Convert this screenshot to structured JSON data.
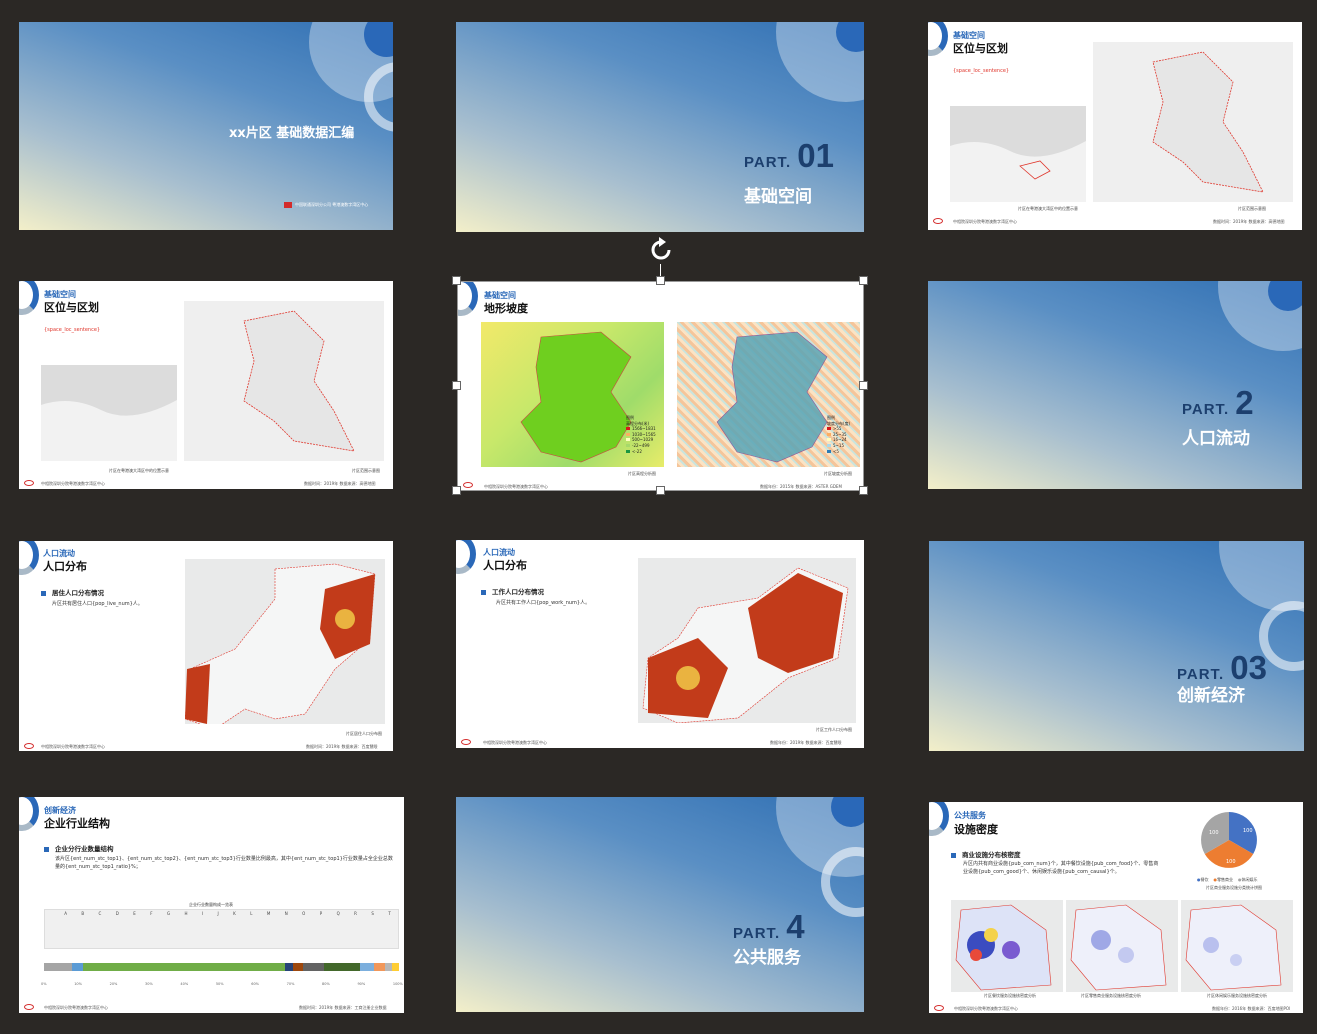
{
  "slides": {
    "s1": {
      "title": "xx片区 基础数据汇编",
      "footer": "中国联通深圳分公司 粤港澳数字湾区中心"
    },
    "s2": {
      "part_label": "PART.",
      "part_num": "01",
      "part_name": "基础空间"
    },
    "s3": {
      "section": "基础空间",
      "title": "区位与区划",
      "placeholder": "{space_loc_sentence}",
      "cap_left": "片区在粤港澳大湾区中的位置示意",
      "cap_right": "片区范围示意图",
      "footer_left": "中相院深圳分院粤港澳数字湾区中心",
      "footer_right": "数据时间：2019年   数据来源：高德地图"
    },
    "s4": {
      "section": "基础空间",
      "title": "区位与区划",
      "placeholder": "{space_loc_sentence}",
      "cap_left": "片区在粤港澳大湾区中的位置示意",
      "cap_right": "片区范围示意图",
      "footer_left": "中相院深圳分院粤港澳数字湾区中心",
      "footer_right": "数据时间：2019年   数据来源：高德地图"
    },
    "s5": {
      "section": "基础空间",
      "title": "地形坡度",
      "legend1_title": "图例",
      "legend1_sub": "高程分布(米)",
      "legend1": [
        "1566~1831",
        "1030~1565",
        "500~1029",
        "-22~499",
        "<-22"
      ],
      "legend2_title": "图例",
      "legend2_sub": "坡度分布(度)",
      "legend2": [
        ">55",
        "25~35",
        "16~24",
        "5~15",
        "<5"
      ],
      "cap_left": "片区高程分析图",
      "cap_right": "片区坡度分析图",
      "footer_left": "中相院深圳分院粤港澳数字湾区中心",
      "footer_right": "数据年份：2015年   数据来源：ASTER GDEM"
    },
    "s6": {
      "part_label": "PART.",
      "part_num": "2",
      "part_name": "人口流动"
    },
    "s7": {
      "section": "人口流动",
      "title": "人口分布",
      "bullet": "居住人口分布情况",
      "body": "片区共有居住人口{pop_live_num}人。",
      "cap": "片区居住人口分布图",
      "footer_left": "中相院深圳分院粤港澳数字湾区中心",
      "footer_right": "数据时间：2019年   数据来源：百度慧眼"
    },
    "s8": {
      "section": "人口流动",
      "title": "人口分布",
      "bullet": "工作人口分布情况",
      "body": "片区共有工作人口{pop_work_num}人。",
      "cap": "片区工作人口分布图",
      "footer_left": "中相院深圳分院粤港澳数字湾区中心",
      "footer_right": "数据年份：2019年   数据来源：百度慧眼"
    },
    "s9": {
      "part_label": "PART.",
      "part_num": "03",
      "part_name": "创新经济"
    },
    "s10": {
      "section": "创新经济",
      "title": "企业行业结构",
      "bullet": "企业分行业数量结构",
      "body": "该片区{ent_num_stc_top1}、{ent_num_stc_top2}、{ent_num_stc_top3}行业数量比例最高，其中{ent_num_stc_top1}行业数量占全企业总数量的{ent_num_stc_top1_ratio}%；",
      "table_title": "企业行业数量构成一览表",
      "table_letters": [
        "A",
        "B",
        "C",
        "D",
        "E",
        "F",
        "G",
        "H",
        "I",
        "J",
        "K",
        "L",
        "M",
        "N",
        "O",
        "P",
        "Q",
        "R",
        "S",
        "T"
      ],
      "axis": [
        "0%",
        "10%",
        "20%",
        "30%",
        "40%",
        "50%",
        "60%",
        "70%",
        "80%",
        "90%",
        "100%"
      ],
      "footer_left": "中相院深圳分院粤港澳数字湾区中心",
      "footer_right": "数据时间：2019年   数据来源：工商注册企业数据"
    },
    "s11": {
      "part_label": "PART.",
      "part_num": "4",
      "part_name": "公共服务"
    },
    "s12": {
      "section": "公共服务",
      "title": "设施密度",
      "bullet": "商业设施分布核密度",
      "body": "片区内共有商业设施{pub_com_num}个，其中餐饮设施{pub_com_food}个、零售商业设施{pub_com_good}个、休闲娱乐设施{pub_com_causal}个。",
      "pie_values": [
        "100",
        "100",
        "100"
      ],
      "legend": [
        "餐饮",
        "零售商业",
        "休闲娱乐"
      ],
      "pie_cap": "片区商业服务设施分类统计饼图",
      "caps": [
        "片区餐饮服务设施核密度分析",
        "片区零售商业服务设施核密度分析",
        "片区休闲娱乐服务设施核密度分析"
      ],
      "footer_left": "中相院深圳分院粤港澳数字湾区中心",
      "footer_right": "数据年份：2016年   数据来源：百度地图POI"
    }
  },
  "colors": {
    "accent": "#2a68b8",
    "background": "#2b2825",
    "red": "#e0362c"
  }
}
